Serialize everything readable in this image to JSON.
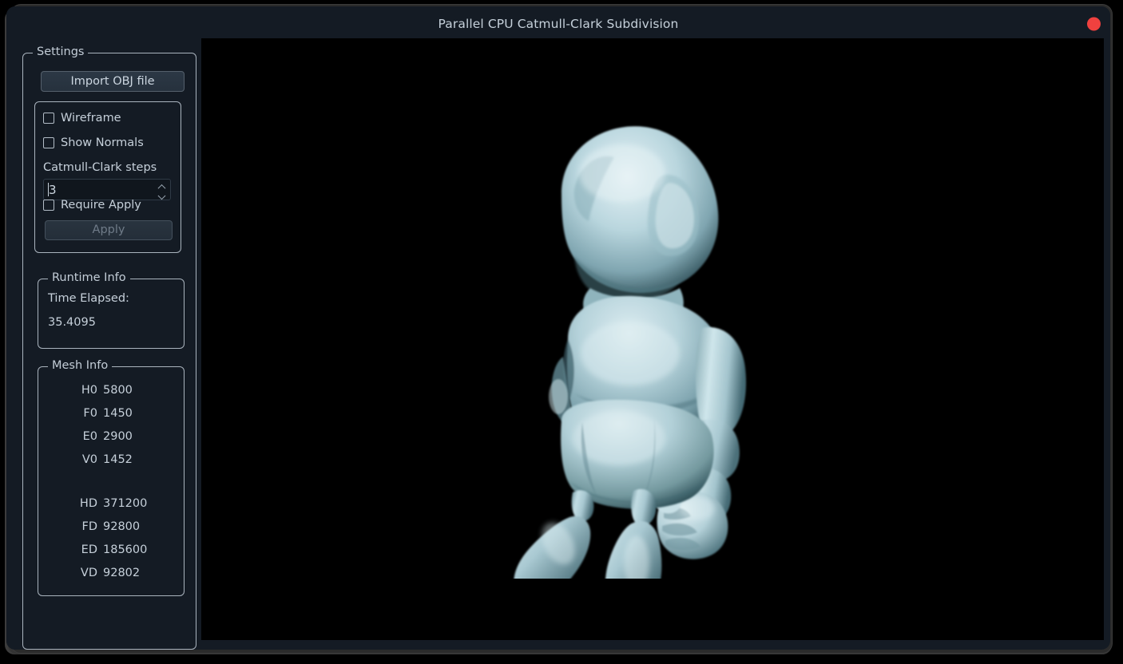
{
  "window": {
    "title": "Parallel CPU Catmull-Clark Subdivision",
    "close_icon": "close-circle-icon"
  },
  "sidebar": {
    "settings_group": {
      "title": "Settings",
      "import_button": "Import OBJ file",
      "options": {
        "wireframe": {
          "label": "Wireframe",
          "checked": false
        },
        "show_normals": {
          "label": "Show Normals",
          "checked": false
        },
        "steps_label": "Catmull-Clark steps",
        "steps_value": "3",
        "require_apply": {
          "label": "Require Apply",
          "checked": false
        },
        "apply_button": "Apply",
        "apply_enabled": false
      }
    },
    "runtime_group": {
      "title": "Runtime Info",
      "time_label": "Time Elapsed:",
      "time_value": "35.4095"
    },
    "mesh_group": {
      "title": "Mesh Info",
      "rows_base": [
        {
          "key": "H0",
          "value": "5800"
        },
        {
          "key": "F0",
          "value": "1450"
        },
        {
          "key": "E0",
          "value": "2900"
        },
        {
          "key": "V0",
          "value": "1452"
        }
      ],
      "rows_subdivided": [
        {
          "key": "HD",
          "value": "371200"
        },
        {
          "key": "FD",
          "value": "92800"
        },
        {
          "key": "ED",
          "value": "185600"
        },
        {
          "key": "VD",
          "value": "92802"
        }
      ]
    }
  },
  "viewport": {
    "background_color": "#000000",
    "model_name": "subdivided-character-mesh",
    "model_base_color": "#b9d6de",
    "model_shadow_color": "#4b6f79"
  },
  "colors": {
    "panel_bg": "#141b24",
    "text": "#c6d0da",
    "border": "#aab4be",
    "close_red": "#f0413f",
    "button_face": "#2c3845"
  }
}
